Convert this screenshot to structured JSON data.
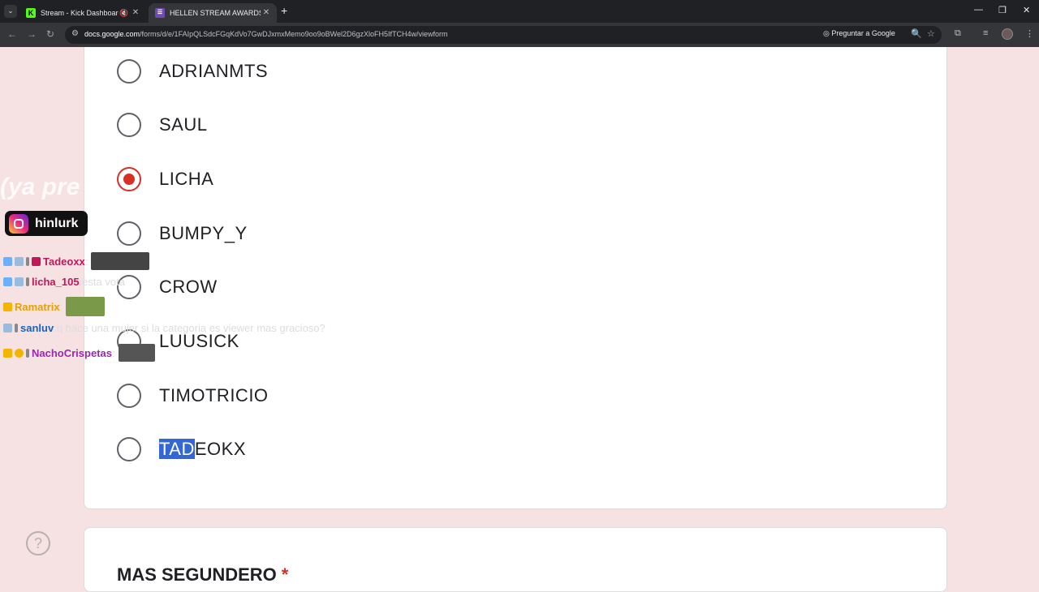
{
  "browser": {
    "tabs": [
      {
        "title": "Stream - Kick Dashboard",
        "active": false
      },
      {
        "title": "HELLEN STREAM AWARDS",
        "active": true
      }
    ],
    "url_domain": "docs.google.com",
    "url_path": "/forms/d/e/1FAIpQLSdcFGqKdVo7GwDJxmxMemo9oo9oBWel2D6gzXloFH5IfTCH4w/viewform",
    "ask_google": "Preguntar a Google"
  },
  "form": {
    "options": [
      "ADRIANMTS",
      "SAUL",
      "LICHA",
      "BUMPY_Y",
      "CROW",
      "LUUSICK",
      "TIMOTRICIO"
    ],
    "selected": "LICHA",
    "last_option_highlight": "TAD",
    "last_option_rest": "EOKX",
    "next_question": "MAS SEGUNDERO",
    "required_mark": "*"
  },
  "overlay": {
    "caption": "(ya pre",
    "instagram": "hinlurk",
    "chat": [
      {
        "user": "Tadeoxx",
        "sep": ":",
        "message": ""
      },
      {
        "user": "licha_105",
        "sep": ":",
        "message": " esta vota"
      },
      {
        "user": "Ramatrix",
        "sep": ":",
        "message": ""
      },
      {
        "user": "sanluv",
        "sep": ":",
        "message": " q hace una mujer si la categoria es viewer mas gracioso?"
      },
      {
        "user": "NachoCrispetas",
        "sep": ":",
        "message": ""
      }
    ]
  },
  "colors": {
    "accent_red": "#d93025",
    "selection_blue": "#3367d6",
    "page_bg": "#f6e1e3"
  }
}
